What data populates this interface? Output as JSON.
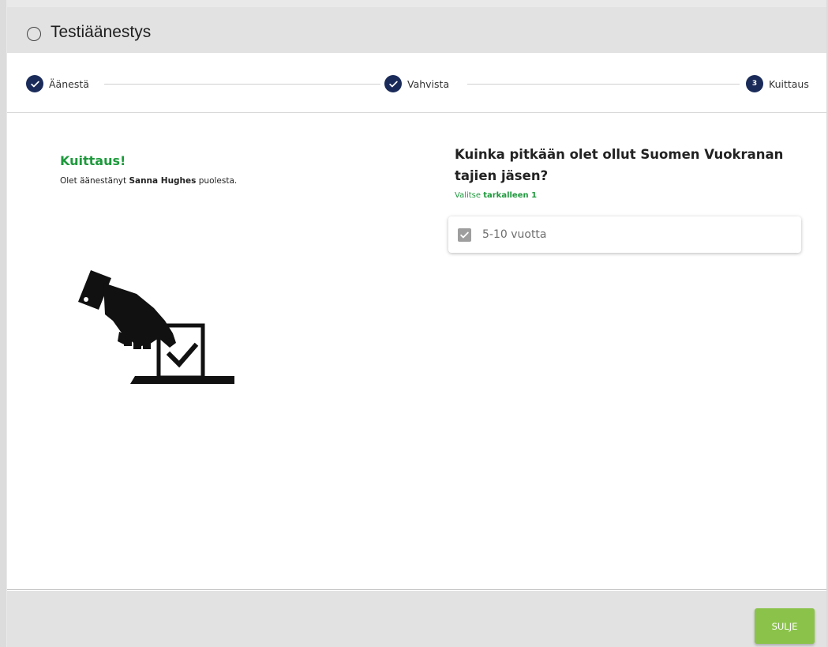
{
  "dialog": {
    "title": "Testiäänestys"
  },
  "stepper": {
    "steps": [
      {
        "label": "Äänestä",
        "state": "done"
      },
      {
        "label": "Vahvista",
        "state": "done"
      },
      {
        "label": "Kuittaus",
        "state": "active",
        "number": "3"
      }
    ]
  },
  "receipt": {
    "heading": "Kuittaus!",
    "text_before": "Olet äänestänyt ",
    "voter_name": "Sanna Hughes",
    "text_after": " puolesta."
  },
  "question": {
    "title": "Kuinka pitkään olet ollut Suomen Vuokranan tajien jäsen?",
    "hint_prefix": "Valitse ",
    "hint_bold": "tarkalleen 1",
    "selected_option": "5-10 vuotta"
  },
  "footer": {
    "close_label": "SULJE"
  },
  "colors": {
    "accent_green": "#1e9a3c",
    "button_green": "#8bc34a",
    "step_navy": "#1a2b5a"
  },
  "icons": {
    "title_status": "radio-unchecked-icon",
    "step_done": "check-circle-icon",
    "illustration": "ballot-box-hand-icon",
    "option_check": "checkbox-checked-icon"
  }
}
